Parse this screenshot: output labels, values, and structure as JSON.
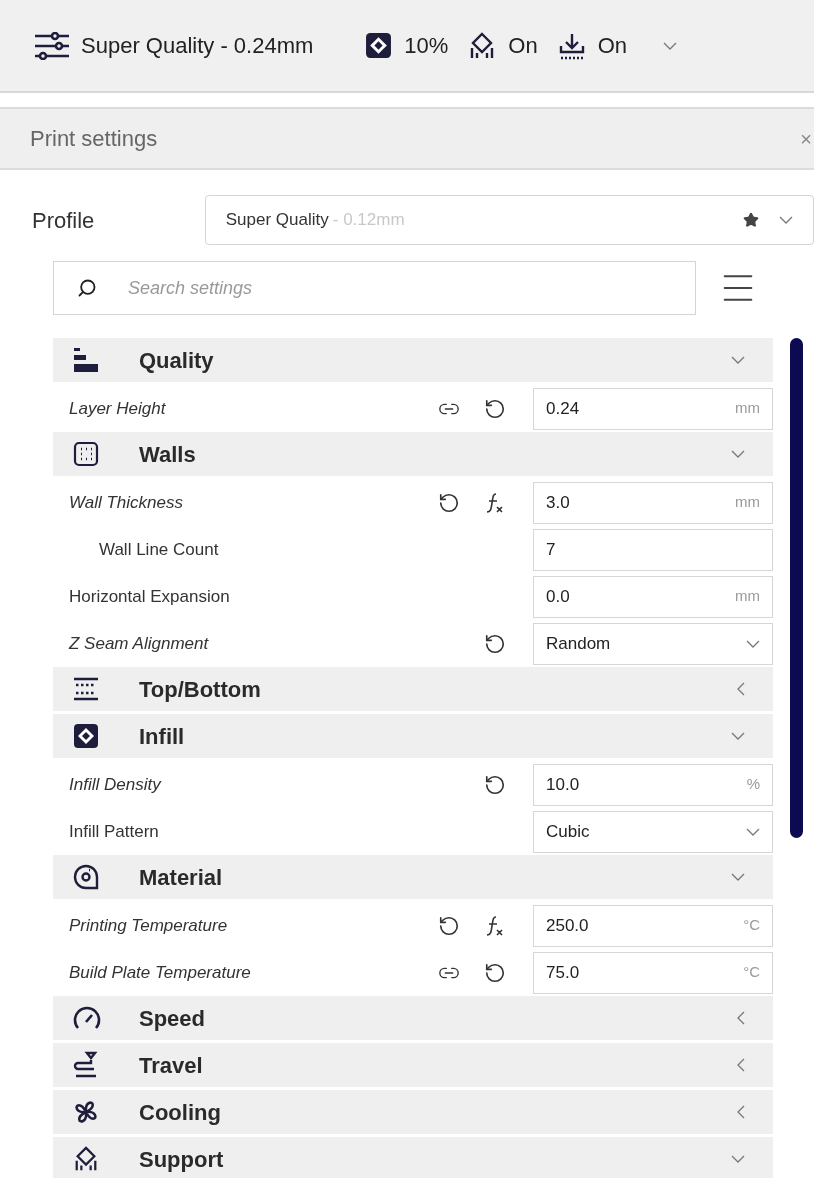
{
  "top_bar": {
    "profile": "Super Quality - 0.24mm",
    "infill": "10%",
    "support": "On",
    "adhesion": "On"
  },
  "panel": {
    "title": "Print settings",
    "close": "×"
  },
  "profile": {
    "label": "Profile",
    "name": "Super Quality",
    "detail": "- 0.12mm"
  },
  "search": {
    "placeholder": "Search settings"
  },
  "sections": [
    {
      "title": "Quality",
      "expanded": true,
      "settings": [
        {
          "label": "Layer Height",
          "modified": true,
          "linked": true,
          "resettable": true,
          "formula": false,
          "kind": "input",
          "value": "0.24",
          "unit": "mm"
        }
      ]
    },
    {
      "title": "Walls",
      "expanded": true,
      "settings": [
        {
          "label": "Wall Thickness",
          "modified": true,
          "linked": false,
          "resettable": true,
          "formula": true,
          "kind": "input",
          "value": "3.0",
          "unit": "mm",
          "children": [
            {
              "label": "Wall Line Count",
              "modified": false,
              "linked": false,
              "resettable": false,
              "formula": false,
              "kind": "input",
              "value": "7"
            }
          ]
        },
        {
          "label": "Horizontal Expansion",
          "modified": false,
          "linked": false,
          "resettable": false,
          "formula": false,
          "kind": "input",
          "value": "0.0",
          "unit": "mm"
        },
        {
          "label": "Z Seam Alignment",
          "modified": true,
          "linked": false,
          "resettable": true,
          "formula": false,
          "kind": "dropdown",
          "value": "Random"
        }
      ]
    },
    {
      "title": "Top/Bottom",
      "expanded": false
    },
    {
      "title": "Infill",
      "expanded": true,
      "settings": [
        {
          "label": "Infill Density",
          "modified": true,
          "linked": false,
          "resettable": true,
          "formula": false,
          "kind": "input",
          "value": "10.0",
          "unit": "%"
        },
        {
          "label": "Infill Pattern",
          "modified": false,
          "linked": false,
          "resettable": false,
          "formula": false,
          "kind": "dropdown",
          "value": "Cubic"
        }
      ]
    },
    {
      "title": "Material",
      "expanded": true,
      "settings": [
        {
          "label": "Printing Temperature",
          "modified": true,
          "linked": false,
          "resettable": true,
          "formula": true,
          "kind": "input",
          "value": "250.0",
          "unit": "°C"
        },
        {
          "label": "Build Plate Temperature",
          "modified": true,
          "linked": true,
          "resettable": true,
          "formula": false,
          "kind": "input",
          "value": "75.0",
          "unit": "°C"
        }
      ]
    },
    {
      "title": "Speed",
      "expanded": false
    },
    {
      "title": "Travel",
      "expanded": false
    },
    {
      "title": "Cooling",
      "expanded": false
    },
    {
      "title": "Support",
      "expanded": true
    }
  ]
}
